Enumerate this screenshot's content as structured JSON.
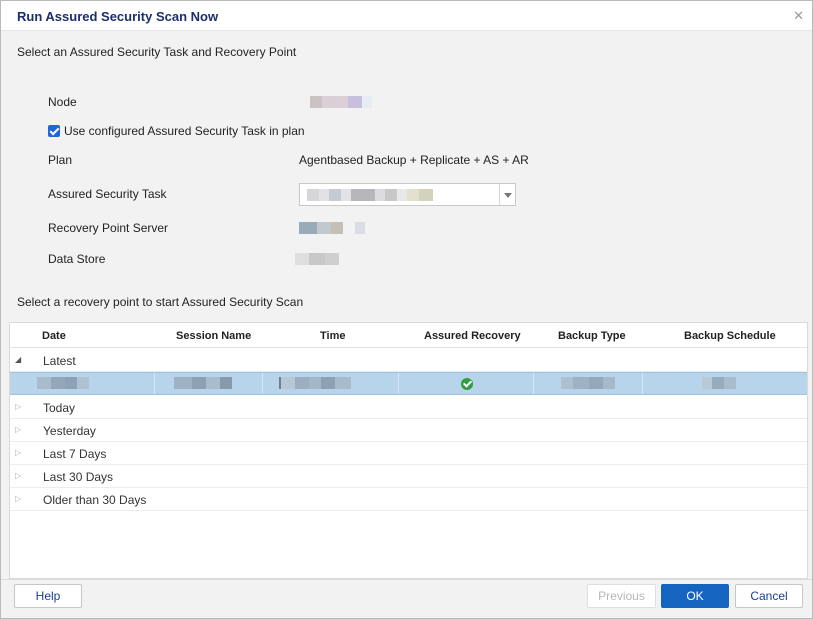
{
  "dialog": {
    "title": "Run Assured Security Scan Now",
    "close_icon": "close-icon"
  },
  "task_section": {
    "heading": "Select an Assured Security Task and Recovery Point",
    "node_label": "Node",
    "use_configured_label": "Use configured Assured Security Task in plan",
    "use_configured_checked": true,
    "plan_label": "Plan",
    "plan_value": "Agentbased Backup + Replicate + AS + AR",
    "task_label": "Assured Security Task",
    "rps_label": "Recovery Point Server",
    "datastore_label": "Data Store"
  },
  "recovery_section": {
    "heading": "Select a recovery point to start Assured Security Scan"
  },
  "grid": {
    "columns": [
      "Date",
      "Session Name",
      "Time",
      "Assured Recovery",
      "Backup Type",
      "Backup Schedule"
    ],
    "groups": [
      {
        "label": "Latest",
        "expanded": true
      },
      {
        "label": "Today",
        "expanded": false
      },
      {
        "label": "Yesterday",
        "expanded": false
      },
      {
        "label": "Last 7 Days",
        "expanded": false
      },
      {
        "label": "Last 30 Days",
        "expanded": false
      },
      {
        "label": "Older than 30 Days",
        "expanded": false
      }
    ],
    "selected_row": {
      "assured_recovery_icon": "success-check-icon"
    }
  },
  "footer": {
    "help": "Help",
    "previous": "Previous",
    "ok": "OK",
    "cancel": "Cancel"
  },
  "colors": {
    "title": "#1b2f6e",
    "selection": "#b8d4ea",
    "primary_button": "#1565c0",
    "success": "#2e9e3f"
  }
}
